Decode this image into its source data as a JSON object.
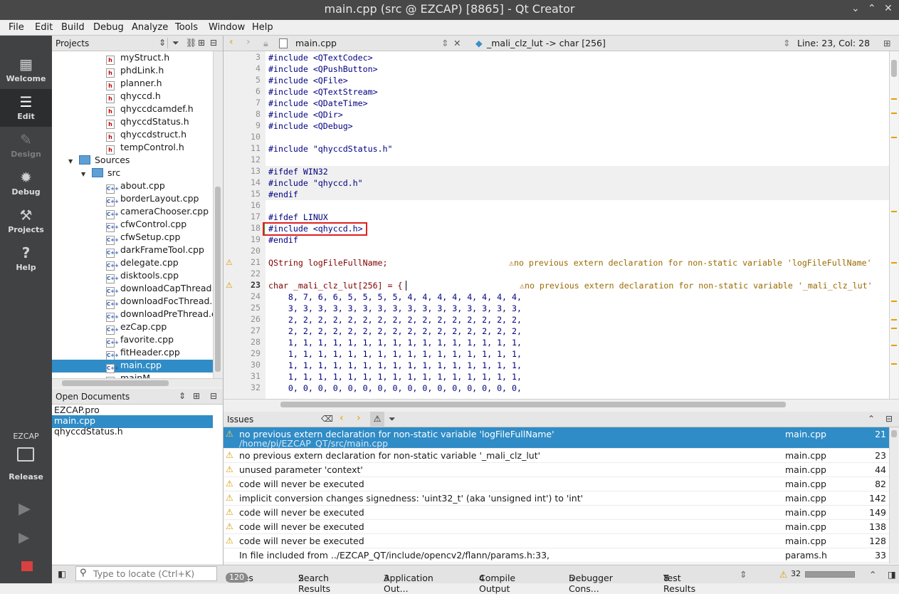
{
  "window": {
    "title": "main.cpp (src @ EZCAP) [8865] - Qt Creator"
  },
  "menu": [
    "File",
    "Edit",
    "Build",
    "Debug",
    "Analyze",
    "Tools",
    "Window",
    "Help"
  ],
  "modes": [
    {
      "label": "Welcome",
      "icon": "grid-icon"
    },
    {
      "label": "Edit",
      "icon": "document-icon"
    },
    {
      "label": "Design",
      "icon": "pencil-icon"
    },
    {
      "label": "Debug",
      "icon": "bug-icon"
    },
    {
      "label": "Projects",
      "icon": "wrench-icon"
    },
    {
      "label": "Help",
      "icon": "question-icon"
    }
  ],
  "kit": {
    "project": "EZCAP",
    "config": "Release"
  },
  "projects": {
    "title": "Projects",
    "headers": [
      "myStruct.h",
      "phdLink.h",
      "planner.h",
      "qhyccd.h",
      "qhyccdcamdef.h",
      "qhyccdStatus.h",
      "qhyccdstruct.h",
      "tempControl.h"
    ],
    "sources_label": "Sources",
    "src_label": "src",
    "sources": [
      "about.cpp",
      "borderLayout.cpp",
      "cameraChooser.cpp",
      "cfwControl.cpp",
      "cfwSetup.cpp",
      "darkFrameTool.cpp",
      "delegate.cpp",
      "disktools.cpp",
      "downloadCapThread.c",
      "downloadFocThread.c",
      "downloadPreThread.c",
      "ezCap.cpp",
      "favorite.cpp",
      "fitHeader.cpp",
      "main.cpp",
      "mainM..."
    ],
    "selected": "main.cpp"
  },
  "open_documents": {
    "title": "Open Documents",
    "items": [
      "EZCAP.pro",
      "main.cpp",
      "qhyccdStatus.h"
    ],
    "selected": "main.cpp"
  },
  "editor": {
    "file": "main.cpp",
    "symbol": "_mali_clz_lut -> char [256]",
    "position": "Line: 23, Col: 28"
  },
  "code": [
    {
      "n": "3",
      "t": "#include <QTextCodec>"
    },
    {
      "n": "4",
      "t": "#include <QPushButton>"
    },
    {
      "n": "5",
      "t": "#include <QFile>"
    },
    {
      "n": "6",
      "t": "#include <QTextStream>"
    },
    {
      "n": "7",
      "t": "#include <QDateTime>"
    },
    {
      "n": "8",
      "t": "#include <QDir>"
    },
    {
      "n": "9",
      "t": "#include <QDebug>"
    },
    {
      "n": "10",
      "t": ""
    },
    {
      "n": "11",
      "t": "#include \"qhyccdStatus.h\""
    },
    {
      "n": "12",
      "t": ""
    },
    {
      "n": "13",
      "t": "#ifdef WIN32"
    },
    {
      "n": "14",
      "t": "#include \"qhyccd.h\""
    },
    {
      "n": "15",
      "t": "#endif"
    },
    {
      "n": "16",
      "t": ""
    },
    {
      "n": "17",
      "t": "#ifdef LINUX"
    },
    {
      "n": "18",
      "t": "#include <qhyccd.h>"
    },
    {
      "n": "19",
      "t": "#endif"
    },
    {
      "n": "20",
      "t": ""
    },
    {
      "n": "21",
      "t": "QString logFileFullName;"
    },
    {
      "n": "22",
      "t": ""
    },
    {
      "n": "23",
      "t": "char _mali_clz_lut[256] = {"
    },
    {
      "n": "24",
      "t": "    8, 7, 6, 6, 5, 5, 5, 5, 4, 4, 4, 4, 4, 4, 4, 4,"
    },
    {
      "n": "25",
      "t": "    3, 3, 3, 3, 3, 3, 3, 3, 3, 3, 3, 3, 3, 3, 3, 3,"
    },
    {
      "n": "26",
      "t": "    2, 2, 2, 2, 2, 2, 2, 2, 2, 2, 2, 2, 2, 2, 2, 2,"
    },
    {
      "n": "27",
      "t": "    2, 2, 2, 2, 2, 2, 2, 2, 2, 2, 2, 2, 2, 2, 2, 2,"
    },
    {
      "n": "28",
      "t": "    1, 1, 1, 1, 1, 1, 1, 1, 1, 1, 1, 1, 1, 1, 1, 1,"
    },
    {
      "n": "29",
      "t": "    1, 1, 1, 1, 1, 1, 1, 1, 1, 1, 1, 1, 1, 1, 1, 1,"
    },
    {
      "n": "30",
      "t": "    1, 1, 1, 1, 1, 1, 1, 1, 1, 1, 1, 1, 1, 1, 1, 1,"
    },
    {
      "n": "31",
      "t": "    1, 1, 1, 1, 1, 1, 1, 1, 1, 1, 1, 1, 1, 1, 1, 1,"
    },
    {
      "n": "32",
      "t": "    0, 0, 0, 0, 0, 0, 0, 0, 0, 0, 0, 0, 0, 0, 0, 0,"
    }
  ],
  "inline_warnings": {
    "w21": "no previous extern declaration for non-static variable 'logFileFullName'",
    "w23": "no previous extern declaration for non-static variable '_mali_clz_lut'"
  },
  "issues": {
    "title": "Issues",
    "rows": [
      {
        "desc": "no previous extern declaration for non-static variable 'logFileFullName'",
        "path": "/home/pi/EZCAP_QT/src/main.cpp",
        "file": "main.cpp",
        "line": "21"
      },
      {
        "desc": "no previous extern declaration for non-static variable '_mali_clz_lut'",
        "file": "main.cpp",
        "line": "23"
      },
      {
        "desc": "unused parameter 'context'",
        "file": "main.cpp",
        "line": "44"
      },
      {
        "desc": "code will never be executed",
        "file": "main.cpp",
        "line": "82"
      },
      {
        "desc": "implicit conversion changes signedness: 'uint32_t' (aka 'unsigned int') to 'int'",
        "file": "main.cpp",
        "line": "142"
      },
      {
        "desc": "code will never be executed",
        "file": "main.cpp",
        "line": "149"
      },
      {
        "desc": "code will never be executed",
        "file": "main.cpp",
        "line": "138"
      },
      {
        "desc": "code will never be executed",
        "file": "main.cpp",
        "line": "128"
      },
      {
        "desc": "In file included from ../EZCAP_QT/include/opencv2/flann/params.h:33,",
        "file": "params.h",
        "line": "33"
      }
    ]
  },
  "statusbar": {
    "locate_placeholder": "Type to locate (Ctrl+K)",
    "tabs": [
      {
        "num": "1",
        "label": "Issues",
        "badge": "120"
      },
      {
        "num": "2",
        "label": "Search Results"
      },
      {
        "num": "3",
        "label": "Application Out..."
      },
      {
        "num": "4",
        "label": "Compile Output"
      },
      {
        "num": "5",
        "label": "Debugger Cons..."
      },
      {
        "num": "8",
        "label": "Test Results"
      }
    ],
    "warning_count": "32"
  }
}
